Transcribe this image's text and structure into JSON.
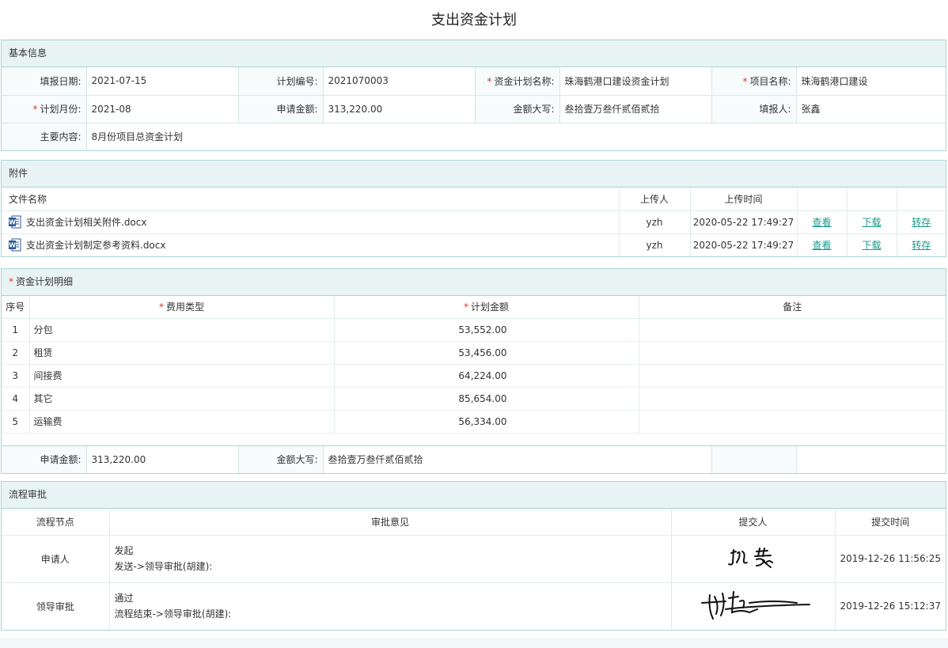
{
  "title": "支出资金计划",
  "basic": {
    "header": "基本信息",
    "fill_date_label": "填报日期:",
    "fill_date": "2021-07-15",
    "plan_no_label": "计划编号:",
    "plan_no": "2021070003",
    "plan_name_label": "资金计划名称:",
    "plan_name": "珠海鹤港口建设资金计划",
    "project_name_label": "项目名称:",
    "project_name": "珠海鹤港口建设",
    "plan_month_label": "计划月份:",
    "plan_month": "2021-08",
    "apply_amount_label": "申请金额:",
    "apply_amount": "313,220.00",
    "amount_upper_label": "金额大写:",
    "amount_upper": "叁拾壹万叁仟贰佰贰拾",
    "filler_label": "填报人:",
    "filler": "张鑫",
    "content_label": "主要内容:",
    "content": "8月份项目总资金计划"
  },
  "attachments": {
    "header": "附件",
    "col_name": "文件名称",
    "col_uploader": "上传人",
    "col_time": "上传时间",
    "view_label": "查看",
    "download_label": "下载",
    "transfer_label": "转存",
    "files": [
      {
        "name": "支出资金计划相关附件.docx",
        "uploader": "yzh",
        "time": "2020-05-22 17:49:27"
      },
      {
        "name": "支出资金计划制定参考资料.docx",
        "uploader": "yzh",
        "time": "2020-05-22 17:49:27"
      }
    ]
  },
  "detail": {
    "header": "资金计划明细",
    "col_seq": "序号",
    "col_type": "费用类型",
    "col_amount": "计划金额",
    "col_remark": "备注",
    "rows": [
      {
        "seq": "1",
        "type": "分包",
        "amount": "53,552.00",
        "remark": ""
      },
      {
        "seq": "2",
        "type": "租赁",
        "amount": "53,456.00",
        "remark": ""
      },
      {
        "seq": "3",
        "type": "间接费",
        "amount": "64,224.00",
        "remark": ""
      },
      {
        "seq": "4",
        "type": "其它",
        "amount": "85,654.00",
        "remark": ""
      },
      {
        "seq": "5",
        "type": "运输费",
        "amount": "56,334.00",
        "remark": ""
      }
    ],
    "sum_apply_label": "申请金额:",
    "sum_apply": "313,220.00",
    "sum_upper_label": "金额大写:",
    "sum_upper": "叁拾壹万叁仟贰佰贰拾"
  },
  "flow": {
    "header": "流程审批",
    "col_node": "流程节点",
    "col_opinion": "审批意见",
    "col_submitter": "提交人",
    "col_time": "提交时间",
    "rows": [
      {
        "node": "申请人",
        "opinion": "发起",
        "route": "发送->领导审批(胡建):",
        "signature": "张鑫",
        "time": "2019-12-26 11:56:25"
      },
      {
        "node": "领导审批",
        "opinion": "通过",
        "route": "流程结束->领导审批(胡建):",
        "signature": "胡建",
        "time": "2019-12-26 15:12:37"
      }
    ]
  },
  "colors": {
    "accent": "#1a9b8e",
    "border": "#a9d6d4",
    "header_bg": "#e8f4f3",
    "required": "#e0342a"
  }
}
